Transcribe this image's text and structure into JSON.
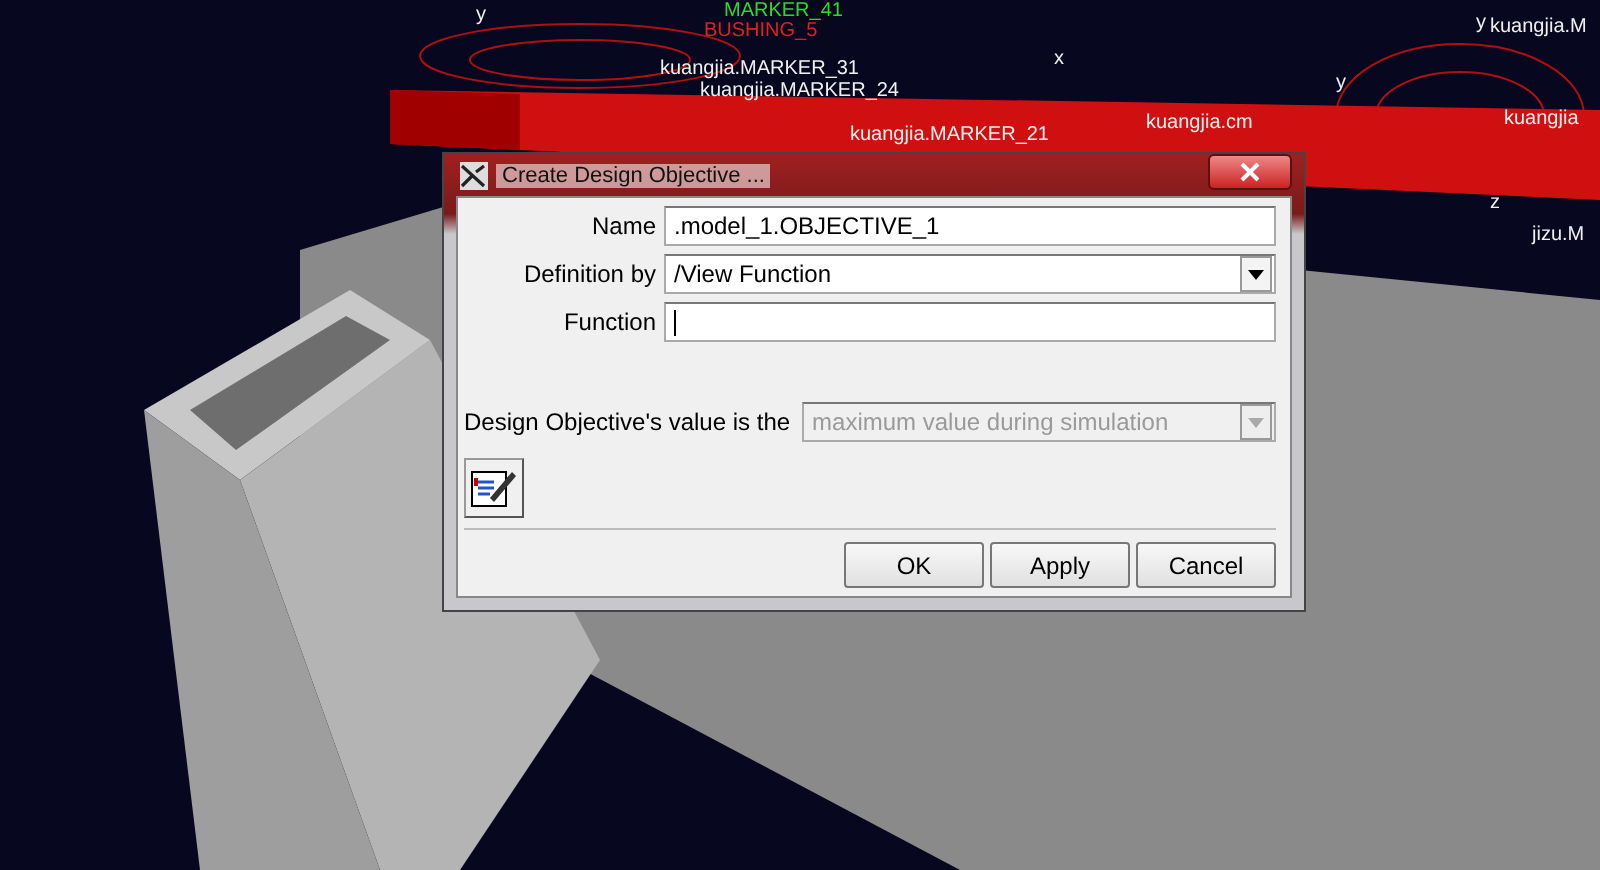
{
  "scene": {
    "labels": [
      {
        "text": "MARKER_41",
        "color": "#2fd82f"
      },
      {
        "text": "BUSHING_5",
        "color": "#e02020"
      },
      {
        "text": "kuangjia.MARKER_31",
        "color": "#f0f0f0"
      },
      {
        "text": "kuangjia.MARKER_24",
        "color": "#f0f0f0"
      },
      {
        "text": "kuangjia.MARKER_21",
        "color": "#f0f0f0"
      },
      {
        "text": "kuangjia.cm",
        "color": "#f0f0f0"
      },
      {
        "text": "kuangjia.M",
        "color": "#f0f0f0"
      },
      {
        "text": "kuangjia",
        "color": "#f0f0f0"
      },
      {
        "text": "jizu.M",
        "color": "#f0f0f0"
      },
      {
        "text": "y",
        "color": "#f0f0f0"
      },
      {
        "text": "x",
        "color": "#f0f0f0"
      },
      {
        "text": "y",
        "color": "#f0f0f0"
      },
      {
        "text": "y",
        "color": "#f0f0f0"
      },
      {
        "text": "z",
        "color": "#f0f0f0"
      }
    ]
  },
  "dialog": {
    "title": "Create Design Objective ...",
    "fields": [
      {
        "kind": "text",
        "label": "Name",
        "value": ".model_1.OBJECTIVE_1"
      },
      {
        "kind": "dropdown",
        "label": "Definition by",
        "value": "/View Function",
        "disabled": false
      },
      {
        "kind": "text",
        "label": "Function",
        "focused": true
      }
    ],
    "objective": {
      "label": "Design Objective's value is the",
      "value": "maximum value during simulation",
      "disabled": true
    },
    "buttons": [
      {
        "label": "OK"
      },
      {
        "label": "Apply"
      },
      {
        "label": "Cancel"
      }
    ]
  }
}
